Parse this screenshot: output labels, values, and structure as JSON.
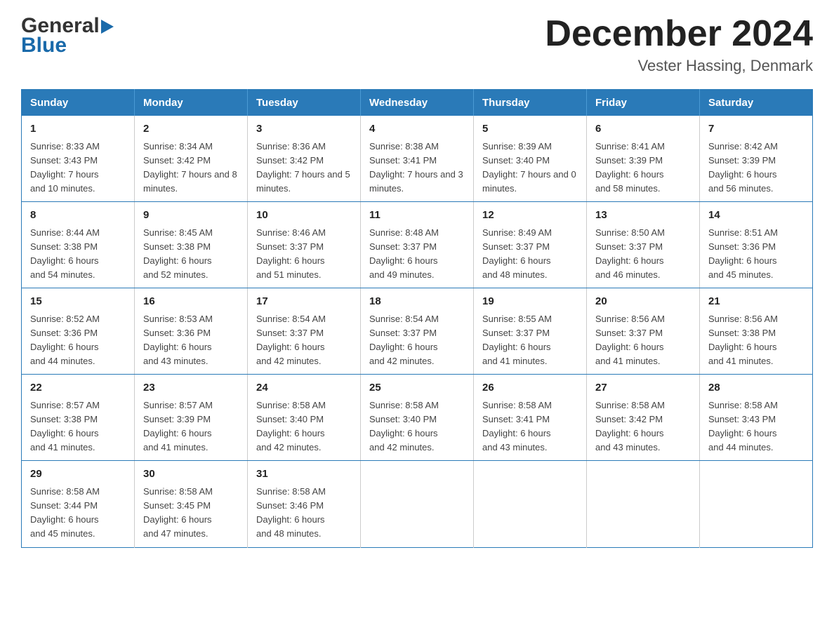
{
  "logo": {
    "general": "General",
    "blue": "Blue"
  },
  "title": {
    "month_year": "December 2024",
    "location": "Vester Hassing, Denmark"
  },
  "days_of_week": [
    "Sunday",
    "Monday",
    "Tuesday",
    "Wednesday",
    "Thursday",
    "Friday",
    "Saturday"
  ],
  "weeks": [
    [
      {
        "day": "1",
        "sunrise": "8:33 AM",
        "sunset": "3:43 PM",
        "daylight": "7 hours and 10 minutes."
      },
      {
        "day": "2",
        "sunrise": "8:34 AM",
        "sunset": "3:42 PM",
        "daylight": "7 hours and 8 minutes."
      },
      {
        "day": "3",
        "sunrise": "8:36 AM",
        "sunset": "3:42 PM",
        "daylight": "7 hours and 5 minutes."
      },
      {
        "day": "4",
        "sunrise": "8:38 AM",
        "sunset": "3:41 PM",
        "daylight": "7 hours and 3 minutes."
      },
      {
        "day": "5",
        "sunrise": "8:39 AM",
        "sunset": "3:40 PM",
        "daylight": "7 hours and 0 minutes."
      },
      {
        "day": "6",
        "sunrise": "8:41 AM",
        "sunset": "3:39 PM",
        "daylight": "6 hours and 58 minutes."
      },
      {
        "day": "7",
        "sunrise": "8:42 AM",
        "sunset": "3:39 PM",
        "daylight": "6 hours and 56 minutes."
      }
    ],
    [
      {
        "day": "8",
        "sunrise": "8:44 AM",
        "sunset": "3:38 PM",
        "daylight": "6 hours and 54 minutes."
      },
      {
        "day": "9",
        "sunrise": "8:45 AM",
        "sunset": "3:38 PM",
        "daylight": "6 hours and 52 minutes."
      },
      {
        "day": "10",
        "sunrise": "8:46 AM",
        "sunset": "3:37 PM",
        "daylight": "6 hours and 51 minutes."
      },
      {
        "day": "11",
        "sunrise": "8:48 AM",
        "sunset": "3:37 PM",
        "daylight": "6 hours and 49 minutes."
      },
      {
        "day": "12",
        "sunrise": "8:49 AM",
        "sunset": "3:37 PM",
        "daylight": "6 hours and 48 minutes."
      },
      {
        "day": "13",
        "sunrise": "8:50 AM",
        "sunset": "3:37 PM",
        "daylight": "6 hours and 46 minutes."
      },
      {
        "day": "14",
        "sunrise": "8:51 AM",
        "sunset": "3:36 PM",
        "daylight": "6 hours and 45 minutes."
      }
    ],
    [
      {
        "day": "15",
        "sunrise": "8:52 AM",
        "sunset": "3:36 PM",
        "daylight": "6 hours and 44 minutes."
      },
      {
        "day": "16",
        "sunrise": "8:53 AM",
        "sunset": "3:36 PM",
        "daylight": "6 hours and 43 minutes."
      },
      {
        "day": "17",
        "sunrise": "8:54 AM",
        "sunset": "3:37 PM",
        "daylight": "6 hours and 42 minutes."
      },
      {
        "day": "18",
        "sunrise": "8:54 AM",
        "sunset": "3:37 PM",
        "daylight": "6 hours and 42 minutes."
      },
      {
        "day": "19",
        "sunrise": "8:55 AM",
        "sunset": "3:37 PM",
        "daylight": "6 hours and 41 minutes."
      },
      {
        "day": "20",
        "sunrise": "8:56 AM",
        "sunset": "3:37 PM",
        "daylight": "6 hours and 41 minutes."
      },
      {
        "day": "21",
        "sunrise": "8:56 AM",
        "sunset": "3:38 PM",
        "daylight": "6 hours and 41 minutes."
      }
    ],
    [
      {
        "day": "22",
        "sunrise": "8:57 AM",
        "sunset": "3:38 PM",
        "daylight": "6 hours and 41 minutes."
      },
      {
        "day": "23",
        "sunrise": "8:57 AM",
        "sunset": "3:39 PM",
        "daylight": "6 hours and 41 minutes."
      },
      {
        "day": "24",
        "sunrise": "8:58 AM",
        "sunset": "3:40 PM",
        "daylight": "6 hours and 42 minutes."
      },
      {
        "day": "25",
        "sunrise": "8:58 AM",
        "sunset": "3:40 PM",
        "daylight": "6 hours and 42 minutes."
      },
      {
        "day": "26",
        "sunrise": "8:58 AM",
        "sunset": "3:41 PM",
        "daylight": "6 hours and 43 minutes."
      },
      {
        "day": "27",
        "sunrise": "8:58 AM",
        "sunset": "3:42 PM",
        "daylight": "6 hours and 43 minutes."
      },
      {
        "day": "28",
        "sunrise": "8:58 AM",
        "sunset": "3:43 PM",
        "daylight": "6 hours and 44 minutes."
      }
    ],
    [
      {
        "day": "29",
        "sunrise": "8:58 AM",
        "sunset": "3:44 PM",
        "daylight": "6 hours and 45 minutes."
      },
      {
        "day": "30",
        "sunrise": "8:58 AM",
        "sunset": "3:45 PM",
        "daylight": "6 hours and 47 minutes."
      },
      {
        "day": "31",
        "sunrise": "8:58 AM",
        "sunset": "3:46 PM",
        "daylight": "6 hours and 48 minutes."
      },
      null,
      null,
      null,
      null
    ]
  ],
  "labels": {
    "sunrise": "Sunrise:",
    "sunset": "Sunset:",
    "daylight": "Daylight:"
  }
}
